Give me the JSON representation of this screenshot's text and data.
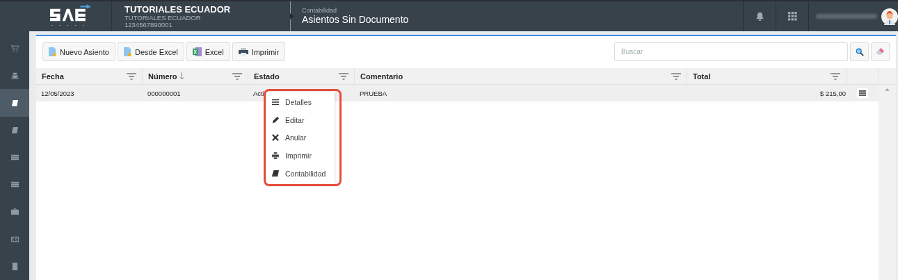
{
  "header": {
    "company": "TUTORIALES ECUADOR",
    "company_sub": "TUTORIALES ECUADOR",
    "ruc": "1234567890001",
    "module": "Contabilidad",
    "page_title": "Asientos Sin Documento"
  },
  "sidebar": {
    "items": [
      {
        "kind": "cart",
        "selected": false
      },
      {
        "kind": "ship",
        "selected": false
      },
      {
        "kind": "book",
        "selected": true
      },
      {
        "kind": "book",
        "selected": false
      },
      {
        "kind": "list",
        "selected": false
      },
      {
        "kind": "list",
        "selected": false
      },
      {
        "kind": "briefcase",
        "selected": false
      },
      {
        "kind": "cc",
        "selected": false
      },
      {
        "kind": "doc",
        "selected": false
      }
    ]
  },
  "toolbar": {
    "buttons": [
      {
        "kind": "doc",
        "label": "Nuevo Asiento"
      },
      {
        "kind": "doc",
        "label": "Desde Excel"
      },
      {
        "kind": "excel",
        "label": "Excel"
      },
      {
        "kind": "print",
        "label": "Imprimir"
      }
    ],
    "search": {
      "placeholder": "Buscar"
    }
  },
  "table": {
    "columns": [
      {
        "label": "Fecha",
        "sorted": false
      },
      {
        "label": "Número",
        "sorted": true
      },
      {
        "label": "Estado",
        "sorted": false
      },
      {
        "label": "Comentario",
        "sorted": false
      },
      {
        "label": "Total",
        "sorted": false
      }
    ],
    "rows": [
      {
        "cells": [
          "12/05/2023",
          "000000001",
          "Acti",
          "PRUEBA",
          "$ 215,00"
        ]
      }
    ]
  },
  "context_menu": {
    "items": [
      {
        "kind": "list",
        "label": "Detalles"
      },
      {
        "kind": "edit",
        "label": "Editar"
      },
      {
        "kind": "cancel",
        "label": "Anular"
      },
      {
        "kind": "print",
        "label": "Imprimir"
      },
      {
        "kind": "book",
        "label": "Contabilidad"
      }
    ]
  }
}
